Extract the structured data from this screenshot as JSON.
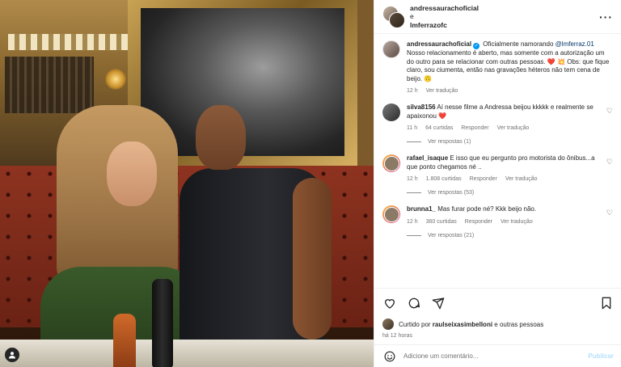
{
  "header": {
    "user1": "andressaurachoficial",
    "joiner": "e",
    "user2": "lmferrazofc"
  },
  "caption": {
    "username": "andressaurachoficial",
    "text_before_mention": "Oficialmente namorando ",
    "mention": "@lmferraz.01",
    "text_after_mention": "Nosso relacionamento é aberto, mas somente com a autorização um do outro para se relacionar com outras pessoas. ❤️ 💥 Obs: que fique claro, sou ciumenta, então nas gravações héteros não tem cena de beijo. 🙃",
    "time": "12 h",
    "translate": "Ver tradução"
  },
  "comments": [
    {
      "username": "silva8156",
      "text": "Aí nesse filme a Andressa beijou kkkkk e realmente se apaixonou ❤️",
      "time": "11 h",
      "likes": "64 curtidas",
      "reply": "Responder",
      "translate": "Ver tradução",
      "replies": "Ver respostas (1)"
    },
    {
      "username": "rafael_isaque",
      "text": "E isso que eu pergunto pro motorista do ônibus...a que ponto chegamos né ..",
      "time": "12 h",
      "likes": "1.808 curtidas",
      "reply": "Responder",
      "translate": "Ver tradução",
      "replies": "Ver respostas (53)"
    },
    {
      "username": "brunna1_",
      "text": "Mas furar pode né? Kkk beijo não.",
      "time": "12 h",
      "likes": "360 curtidas",
      "reply": "Responder",
      "translate": "Ver tradução",
      "replies": "Ver respostas (21)"
    }
  ],
  "likes": {
    "prefix": "Curtido por ",
    "user": "raulseixasimbelloni",
    "suffix": " e outras pessoas",
    "ago": "há 12 horas"
  },
  "add_comment": {
    "placeholder": "Adicione um comentário...",
    "publish": "Publicar"
  },
  "icons": {
    "more": "more-icon",
    "like": "heart-icon",
    "comment": "comment-icon",
    "share": "share-icon",
    "save": "bookmark-icon",
    "emoji": "emoji-icon",
    "tag": "user-tag-icon"
  }
}
